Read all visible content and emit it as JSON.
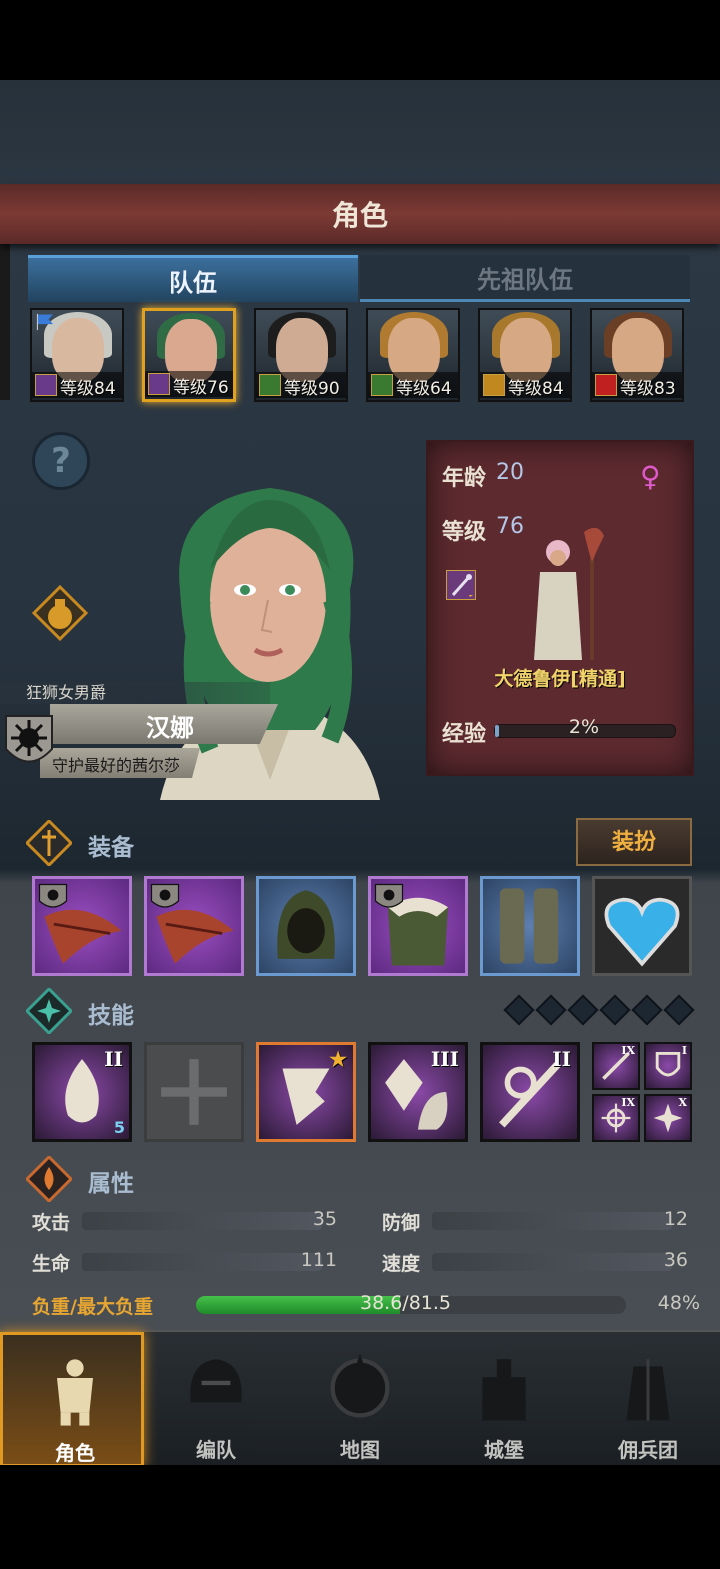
{
  "header": {
    "title": "角色"
  },
  "tabs": [
    {
      "label": "队伍",
      "active": true
    },
    {
      "label": "先祖队伍",
      "active": false
    }
  ],
  "party": [
    {
      "level_text": "等级84",
      "class_icon": "staff-icon",
      "class_color": "#6a3a8a",
      "hair": "#c9c9c4",
      "skin": "#d9b8a0",
      "flag": true,
      "selected": false
    },
    {
      "level_text": "等级76",
      "class_icon": "staff-icon",
      "class_color": "#6a3a8a",
      "hair": "#2f6b45",
      "skin": "#d9a88f",
      "flag": false,
      "selected": true
    },
    {
      "level_text": "等级90",
      "class_icon": "crossed-swords-icon",
      "class_color": "#3a7a30",
      "hair": "#1d1d1d",
      "skin": "#d0ab94",
      "flag": false,
      "selected": false
    },
    {
      "level_text": "等级64",
      "class_icon": "crossed-swords-icon",
      "class_color": "#3a7a30",
      "hair": "#b07a30",
      "skin": "#d6a884",
      "flag": false,
      "selected": false
    },
    {
      "level_text": "等级84",
      "class_icon": "shield-icon",
      "class_color": "#c28820",
      "hair": "#a8782c",
      "skin": "#d6a884",
      "flag": false,
      "selected": false
    },
    {
      "level_text": "等级83",
      "class_icon": "wolf-icon",
      "class_color": "#c02020",
      "hair": "#6a3f25",
      "skin": "#d6a884",
      "flag": false,
      "selected": false
    }
  ],
  "hero": {
    "title": "狂狮女男爵",
    "name": "汉娜",
    "subtitle": "守护最好的茜尔莎",
    "hair_color": "#2f7a4a"
  },
  "info": {
    "age_label": "年龄",
    "age_value": "20",
    "level_label": "等级",
    "level_value": "76",
    "sex_symbol": "♀",
    "class_name": "大德鲁伊[精通]",
    "exp_label": "经验",
    "exp_text": "2%",
    "exp_fraction": 0.02
  },
  "sections": {
    "equipment": "装备",
    "skills": "技能",
    "attributes": "属性"
  },
  "dress_button": "装扮",
  "equipment": [
    {
      "name": "feather-cloak-icon",
      "rarity": "purple",
      "crest": true
    },
    {
      "name": "feather-cloak-icon",
      "rarity": "purple",
      "crest": true
    },
    {
      "name": "hood-icon",
      "rarity": "blue",
      "crest": false
    },
    {
      "name": "fur-armor-icon",
      "rarity": "purple",
      "crest": true
    },
    {
      "name": "boots-icon",
      "rarity": "blue",
      "crest": false
    },
    {
      "name": "heart-amulet-icon",
      "rarity": "dark",
      "crest": false
    }
  ],
  "skills": [
    {
      "name": "flame-skill-icon",
      "rank": "II",
      "badge": "5"
    },
    {
      "name": "empty-slot-icon",
      "rank": "",
      "badge": ""
    },
    {
      "name": "tornado-skill-icon",
      "rank": "★",
      "badge": ""
    },
    {
      "name": "crystal-skill-icon",
      "rank": "III",
      "badge": ""
    },
    {
      "name": "staff-skill-icon",
      "rank": "II",
      "badge": ""
    }
  ],
  "passive_skills": [
    {
      "name": "staff-passive-icon",
      "rank": "IX"
    },
    {
      "name": "shield-passive-icon",
      "rank": "I"
    },
    {
      "name": "target-passive-icon",
      "rank": "IX"
    },
    {
      "name": "burst-passive-icon",
      "rank": "X"
    }
  ],
  "attributes": [
    {
      "label": "攻击",
      "value": "35"
    },
    {
      "label": "防御",
      "value": "12"
    },
    {
      "label": "生命",
      "value": "111"
    },
    {
      "label": "速度",
      "value": "36"
    }
  ],
  "load": {
    "label": "负重/最大负重",
    "text": "38.6/81.5",
    "percent": "48%",
    "fraction": 0.474
  },
  "nav": [
    {
      "label": "角色",
      "icon": "knight-icon",
      "active": true
    },
    {
      "label": "编队",
      "icon": "helmet-icon",
      "active": false
    },
    {
      "label": "地图",
      "icon": "compass-map-icon",
      "active": false
    },
    {
      "label": "城堡",
      "icon": "castle-icon",
      "active": false
    },
    {
      "label": "佣兵团",
      "icon": "mercenary-icon",
      "active": false
    }
  ]
}
